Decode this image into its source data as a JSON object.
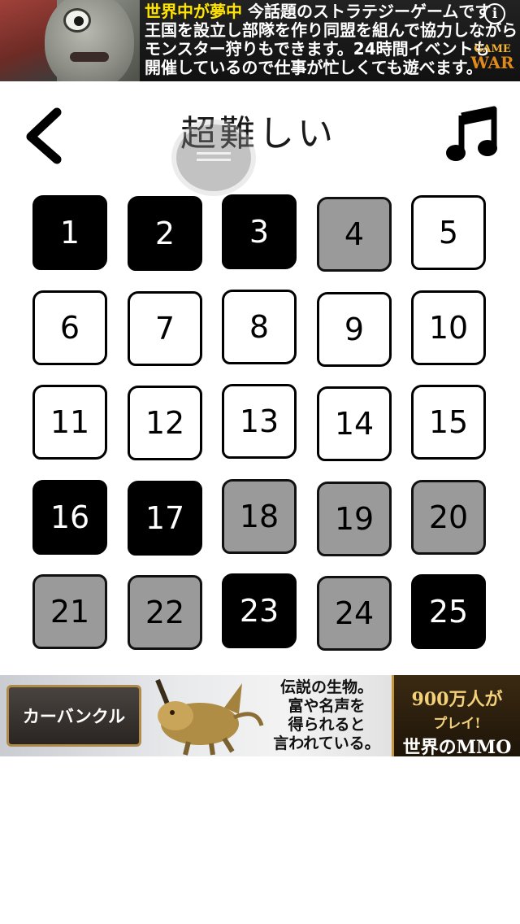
{
  "top_ad": {
    "headline_highlight": "世界中が夢中",
    "headline_rest": "今話題のストラテジーゲームです",
    "line2": "王国を設立し部隊を作り同盟を組んで協力しながら",
    "line3": "モンスター狩りもできます。24時間イベントも",
    "line4": "開催しているので仕事が忙しくても遊べます。",
    "info_glyph": "i",
    "logo_line1": "GAME",
    "logo_line2": "WAR"
  },
  "header": {
    "title": "超難しい",
    "back_icon": "chevron-left-icon",
    "music_icon": "music-note-icon",
    "menu_icon": "menu-icon"
  },
  "levels": [
    {
      "label": "1",
      "state": "black"
    },
    {
      "label": "2",
      "state": "black"
    },
    {
      "label": "3",
      "state": "black"
    },
    {
      "label": "4",
      "state": "gray"
    },
    {
      "label": "5",
      "state": "white"
    },
    {
      "label": "6",
      "state": "white"
    },
    {
      "label": "7",
      "state": "white"
    },
    {
      "label": "8",
      "state": "white"
    },
    {
      "label": "9",
      "state": "white"
    },
    {
      "label": "10",
      "state": "white"
    },
    {
      "label": "11",
      "state": "white"
    },
    {
      "label": "12",
      "state": "white"
    },
    {
      "label": "13",
      "state": "white"
    },
    {
      "label": "14",
      "state": "white"
    },
    {
      "label": "15",
      "state": "white"
    },
    {
      "label": "16",
      "state": "black"
    },
    {
      "label": "17",
      "state": "black"
    },
    {
      "label": "18",
      "state": "gray"
    },
    {
      "label": "19",
      "state": "gray"
    },
    {
      "label": "20",
      "state": "gray"
    },
    {
      "label": "21",
      "state": "gray"
    },
    {
      "label": "22",
      "state": "gray"
    },
    {
      "label": "23",
      "state": "black"
    },
    {
      "label": "24",
      "state": "gray"
    },
    {
      "label": "25",
      "state": "black"
    }
  ],
  "bottom_ad": {
    "name": "カーバンクル",
    "line1": "伝説の生物。",
    "line2": "富や名声を",
    "line3": "得られると",
    "line4": "言われている。",
    "players_line1": "900万人が",
    "players_line2": "プレイ!",
    "players_line3": "世界のMMO"
  },
  "colors": {
    "tile_black": "#000000",
    "tile_gray": "#9a9a9a",
    "tile_white": "#ffffff",
    "ad_highlight": "#ffe400"
  }
}
